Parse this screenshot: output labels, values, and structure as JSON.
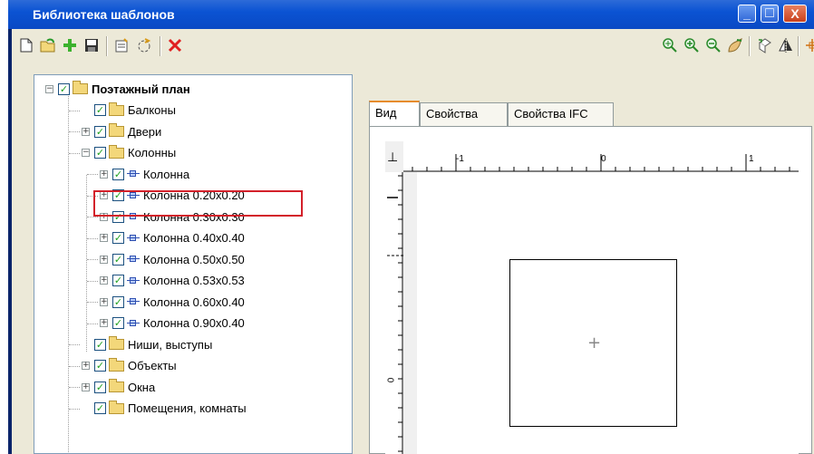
{
  "window": {
    "title": "Библиотека шаблонов",
    "minimize_glyph": "_",
    "maximize_glyph": "□",
    "close_glyph": "X"
  },
  "toolbar": {
    "left_icons": [
      "new-icon",
      "open-icon",
      "add-icon",
      "save-icon",
      "properties-icon",
      "refresh-icon",
      "delete-icon"
    ],
    "right_icons": [
      "zoom-all-icon",
      "zoom-in-icon",
      "zoom-out-icon",
      "pan-icon",
      "rotate-icon",
      "mirror-icon",
      "snap-point-icon"
    ]
  },
  "tree": {
    "root": {
      "label": "Поэтажный план",
      "checked": true
    },
    "items": [
      {
        "label": "Балконы",
        "level": 1,
        "expander": "",
        "icon": "folder"
      },
      {
        "label": "Двери",
        "level": 1,
        "expander": "+",
        "icon": "folder"
      },
      {
        "label": "Колонны",
        "level": 1,
        "expander": "−",
        "icon": "folder"
      },
      {
        "label": "Колонна",
        "level": 2,
        "expander": "+",
        "icon": "column"
      },
      {
        "label": "Колонна 0.20x0.20",
        "level": 2,
        "expander": "+",
        "icon": "column"
      },
      {
        "label": "Колонна 0.30x0.30",
        "level": 2,
        "expander": "+",
        "icon": "column"
      },
      {
        "label": "Колонна 0.40x0.40",
        "level": 2,
        "expander": "+",
        "icon": "column"
      },
      {
        "label": "Колонна 0.50x0.50",
        "level": 2,
        "expander": "+",
        "icon": "column"
      },
      {
        "label": "Колонна 0.53x0.53",
        "level": 2,
        "expander": "+",
        "icon": "column"
      },
      {
        "label": "Колонна 0.60x0.40",
        "level": 2,
        "expander": "+",
        "icon": "column"
      },
      {
        "label": "Колонна 0.90x0.40",
        "level": 2,
        "expander": "+",
        "icon": "column"
      },
      {
        "label": "Ниши, выступы",
        "level": 1,
        "expander": "",
        "icon": "folder"
      },
      {
        "label": "Объекты",
        "level": 1,
        "expander": "+",
        "icon": "folder"
      },
      {
        "label": "Окна",
        "level": 1,
        "expander": "+",
        "icon": "folder"
      },
      {
        "label": "Помещения, комнаты",
        "level": 1,
        "expander": "",
        "icon": "folder"
      }
    ],
    "highlight_color": "#d3202a"
  },
  "tabs": [
    {
      "label": "Вид",
      "active": true
    },
    {
      "label": "Свойства",
      "active": false
    },
    {
      "label": "Свойства IFC",
      "active": false
    }
  ],
  "ruler": {
    "h_labels": [
      "-1",
      "0",
      "1"
    ],
    "v_labels": [
      "0"
    ],
    "axis_glyph": "⊥"
  },
  "preview": {
    "center_mark": "+"
  }
}
